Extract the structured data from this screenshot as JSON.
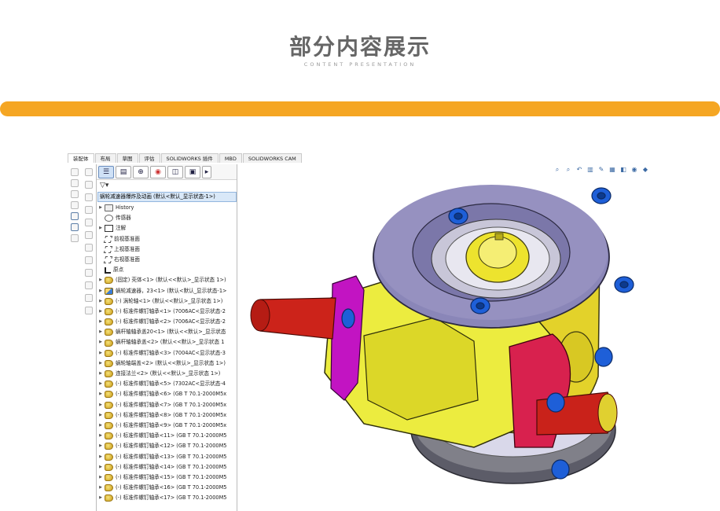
{
  "page": {
    "title": "部分内容展示",
    "subtitle": "CONTENT PRESENTATION"
  },
  "colors": {
    "accent_bar": "#f5a623",
    "part_yellow": "#e8e23a",
    "cover_purple": "#8a86b8",
    "flange_magenta": "#c214c2",
    "flange_red": "#d8214e",
    "shaft_red": "#d0231d",
    "base_gray": "#5c5c68",
    "bolt_blue": "#1e5fd8"
  },
  "command_tabs": [
    "装配体",
    "布局",
    "草图",
    "评估",
    "SOLIDWORKS 插件",
    "MBD",
    "SOLIDWORKS CAM"
  ],
  "feature_manager": {
    "toolbar_icons": [
      "feature-tree-icon",
      "property-icon",
      "config-icon",
      "dimxpert-icon",
      "display-icon",
      "cam-icon",
      "more-icon"
    ],
    "filter_icon": "filter-icon",
    "root": "蜗轮减速器爆炸及动画 (默认<默认_显示状态-1>)",
    "nodes": [
      {
        "label": "History",
        "icon": "hist",
        "arrow": "▶"
      },
      {
        "label": "传感器",
        "icon": "sensor",
        "arrow": ""
      },
      {
        "label": "注解",
        "icon": "annot",
        "arrow": "▶"
      },
      {
        "label": "前视基准面",
        "icon": "plane",
        "arrow": ""
      },
      {
        "label": "上视基准面",
        "icon": "plane",
        "arrow": ""
      },
      {
        "label": "右视基准面",
        "icon": "plane",
        "arrow": ""
      },
      {
        "label": "原点",
        "icon": "origin",
        "arrow": ""
      },
      {
        "label": "(固定) 壳体<1> (默认<<默认>_显示状态 1>)",
        "icon": "part",
        "arrow": "▶"
      },
      {
        "label": "蜗轮减速器，23<1> (默认<默认_显示状态-1>",
        "icon": "asm",
        "arrow": "▶"
      },
      {
        "label": "(-) 涡轮轴<1> (默认<<默认>_显示状态 1>)",
        "icon": "part",
        "arrow": "▶"
      },
      {
        "label": "(-) 标准件螺钉轴承<1> (7006AC<显示状态-2",
        "icon": "part",
        "arrow": "▶"
      },
      {
        "label": "(-) 标准件螺钉轴承<2> (7006AC<显示状态-2",
        "icon": "part",
        "arrow": "▶"
      },
      {
        "label": "蜗杆轴轴承盖20<1> (默认<<默认>_显示状态",
        "icon": "part",
        "arrow": "▶"
      },
      {
        "label": "蜗杆轴轴承盖<2> (默认<<默认>_显示状态 1",
        "icon": "part",
        "arrow": "▶"
      },
      {
        "label": "(-) 标准件螺钉轴承<3> (7004AC<显示状态-3",
        "icon": "part",
        "arrow": "▶"
      },
      {
        "label": "蜗轮轴端盖<2> (默认<<默认>_显示状态 1>)",
        "icon": "part",
        "arrow": "▶"
      },
      {
        "label": "连接法兰<2> (默认<<默认>_显示状态 1>)",
        "icon": "part",
        "arrow": "▶"
      },
      {
        "label": "(-) 标准件螺钉轴承<5> (7302AC<显示状态-4",
        "icon": "part",
        "arrow": "▶"
      },
      {
        "label": "(-) 标准件螺钉轴承<6> (GB T 70.1-2000M5x",
        "icon": "part",
        "arrow": "▶"
      },
      {
        "label": "(-) 标准件螺钉轴承<7> (GB T 70.1-2000M5x",
        "icon": "part",
        "arrow": "▶"
      },
      {
        "label": "(-) 标准件螺钉轴承<8> (GB T 70.1-2000M5x",
        "icon": "part",
        "arrow": "▶"
      },
      {
        "label": "(-) 标准件螺钉轴承<9> (GB T 70.1-2000M5x",
        "icon": "part",
        "arrow": "▶"
      },
      {
        "label": "(-) 标准件螺钉轴承<11> (GB T 70.1-2000M5",
        "icon": "part",
        "arrow": "▶"
      },
      {
        "label": "(-) 标准件螺钉轴承<12> (GB T 70.1-2000M5",
        "icon": "part",
        "arrow": "▶"
      },
      {
        "label": "(-) 标准件螺钉轴承<13> (GB T 70.1-2000M5",
        "icon": "part",
        "arrow": "▶"
      },
      {
        "label": "(-) 标准件螺钉轴承<14> (GB T 70.1-2000M5",
        "icon": "part",
        "arrow": "▶"
      },
      {
        "label": "(-) 标准件螺钉轴承<15> (GB T 70.1-2000M5",
        "icon": "part",
        "arrow": "▶"
      },
      {
        "label": "(-) 标准件螺钉轴承<16> (GB T 70.1-2000M5",
        "icon": "part",
        "arrow": "▶"
      },
      {
        "label": "(-) 标准件螺钉轴承<17> (GB T 70.1-2000M5",
        "icon": "part",
        "arrow": "▶"
      }
    ]
  },
  "view_toolbar_icons": [
    "zoom-fit-icon",
    "zoom-area-icon",
    "previous-view-icon",
    "section-view-icon",
    "dynamic-annotation-icon",
    "view-orientation-icon",
    "display-style-icon",
    "hide-show-icon",
    "appearance-icon"
  ]
}
